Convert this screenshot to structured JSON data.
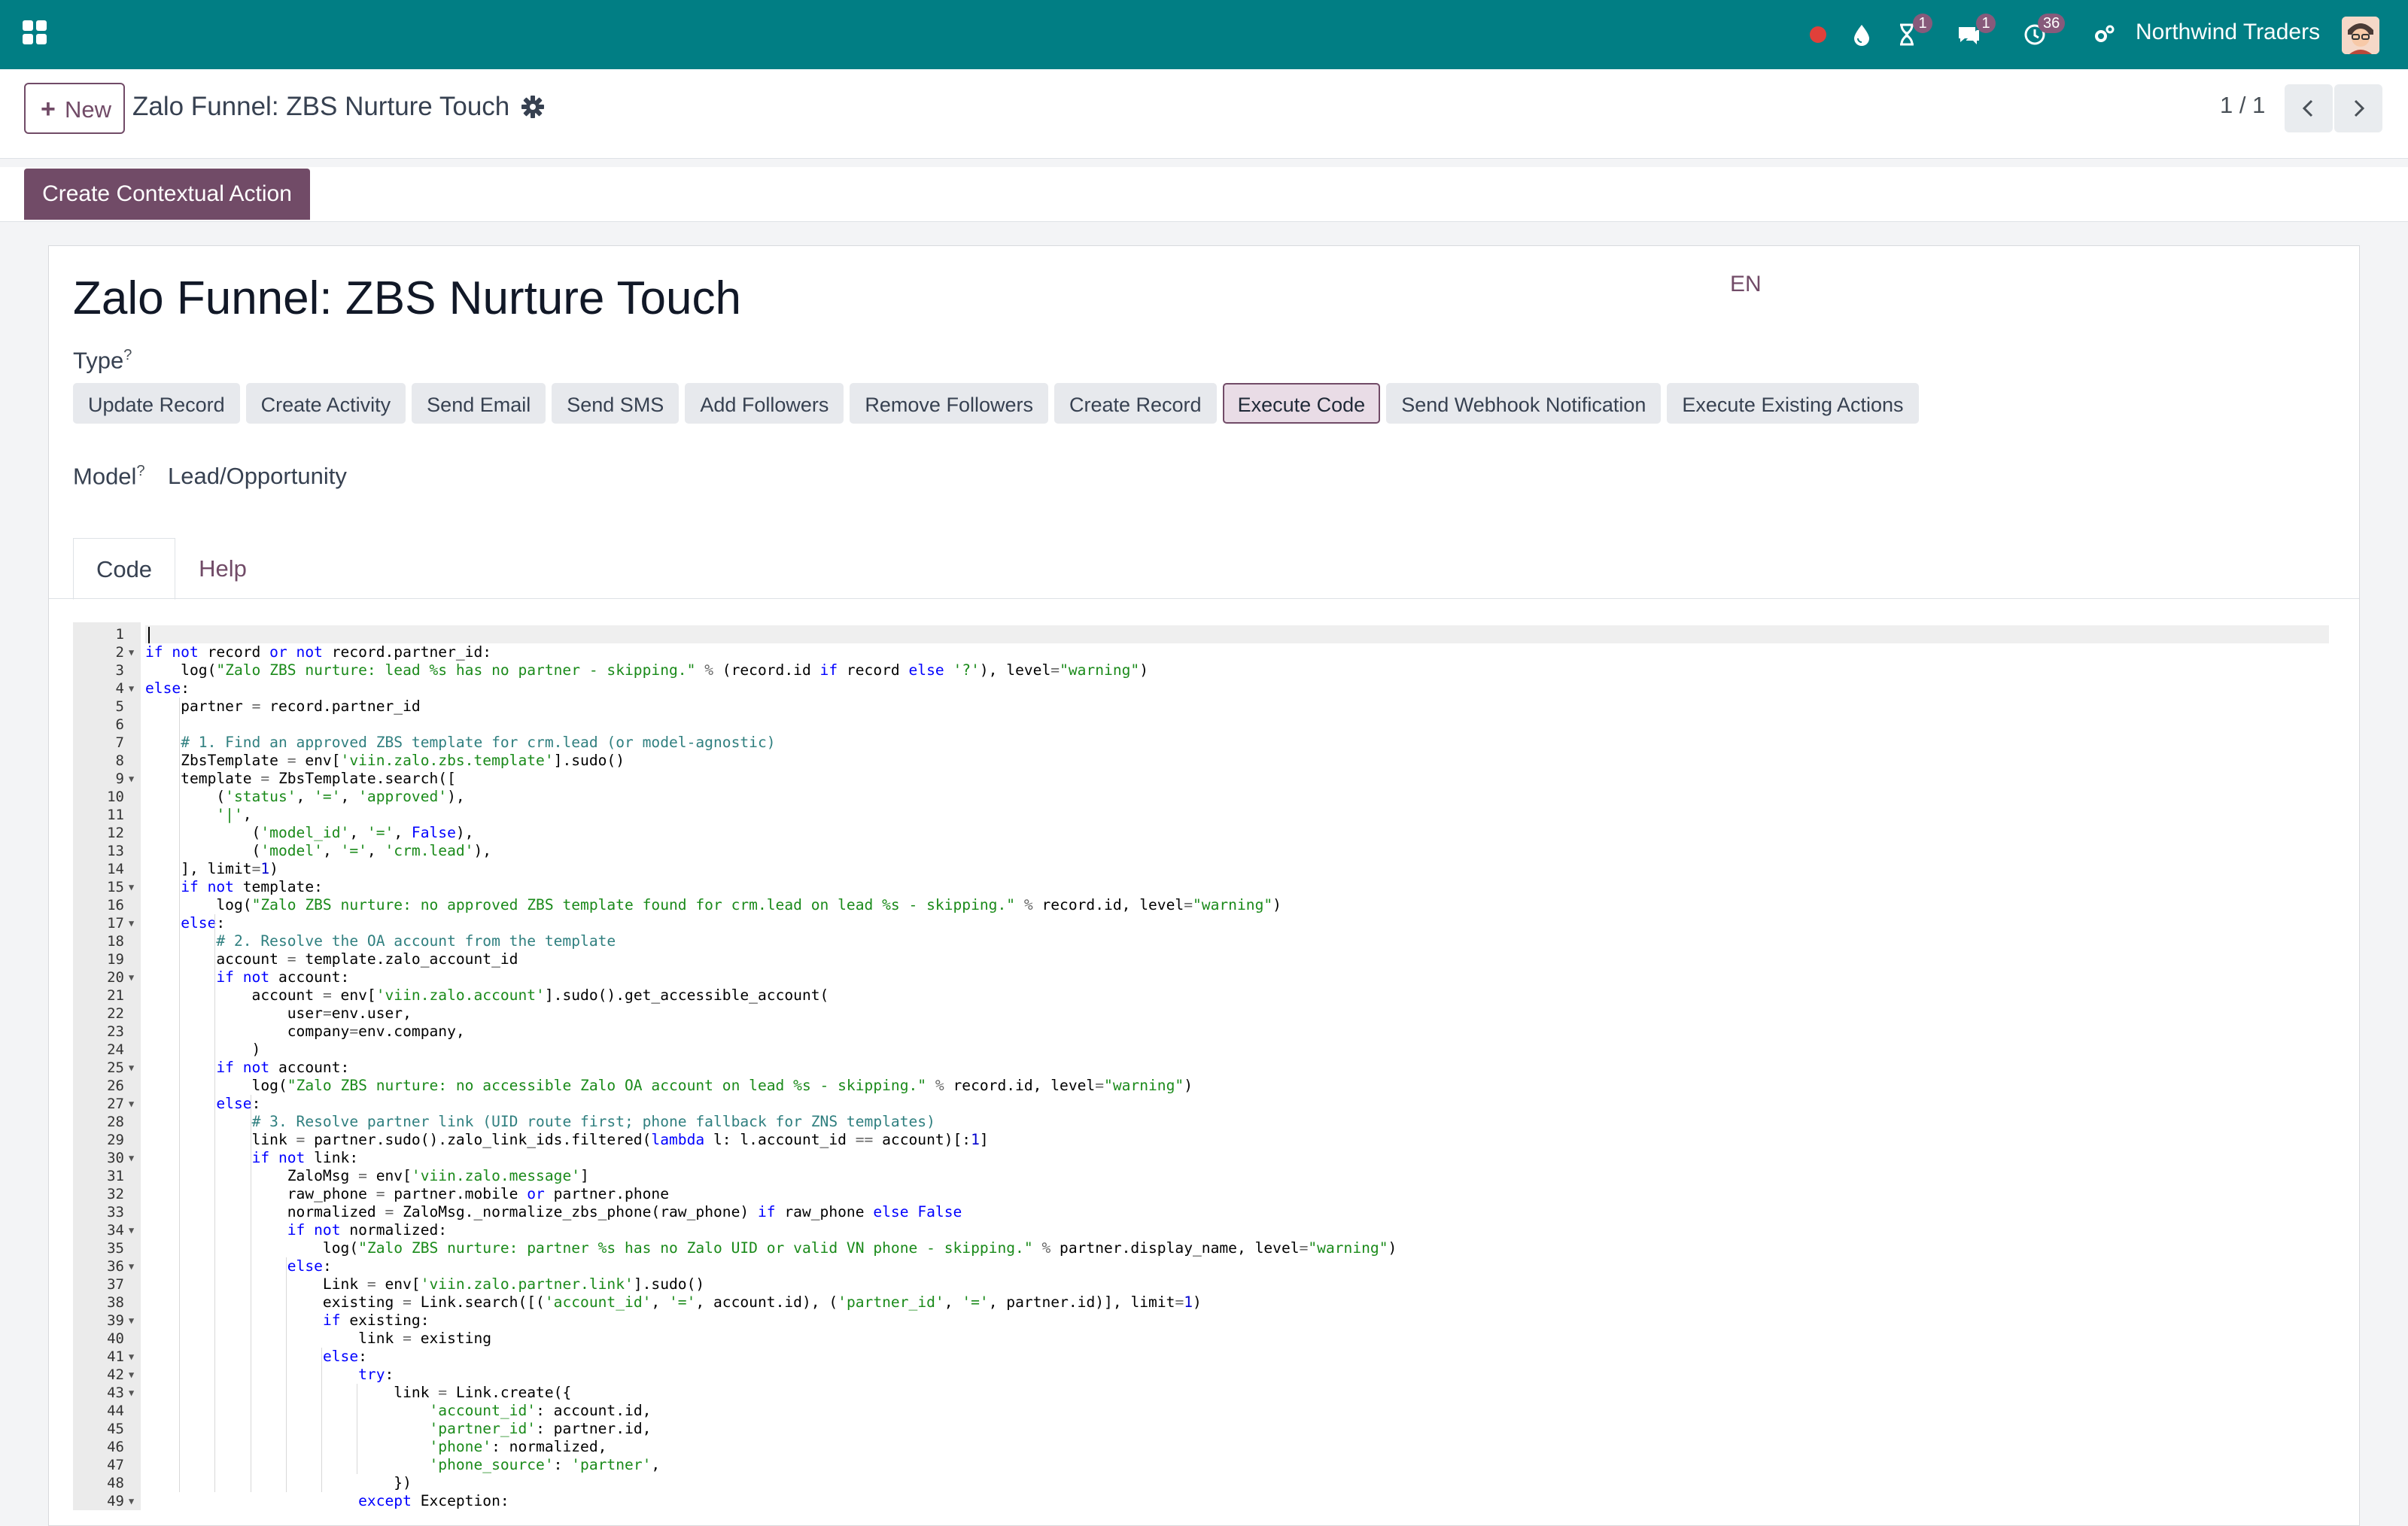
{
  "navbar": {
    "company": "Northwind Traders",
    "activity_badge": "1",
    "messages_badge": "1",
    "activities_badge": "36"
  },
  "control_panel": {
    "new_label": "New",
    "breadcrumb": "Zalo Funnel: ZBS Nurture Touch",
    "pager": "1 / 1"
  },
  "actions": {
    "create_contextual": "Create Contextual Action"
  },
  "form": {
    "name": "Zalo Funnel: ZBS Nurture Touch",
    "lang": "EN",
    "type_label": "Type",
    "type_help": "?",
    "types": [
      "Update Record",
      "Create Activity",
      "Send Email",
      "Send SMS",
      "Add Followers",
      "Remove Followers",
      "Create Record",
      "Execute Code",
      "Send Webhook Notification",
      "Execute Existing Actions"
    ],
    "active_type": "Execute Code",
    "model_label": "Model",
    "model_help": "?",
    "model_value": "Lead/Opportunity",
    "tabs": [
      "Code",
      "Help"
    ],
    "active_tab": "Code"
  },
  "code": [
    "",
    "if not record or not record.partner_id:",
    "    log(\"Zalo ZBS nurture: lead %s has no partner - skipping.\" % (record.id if record else '?'), level=\"warning\")",
    "else:",
    "    partner = record.partner_id",
    "",
    "    # 1. Find an approved ZBS template for crm.lead (or model-agnostic)",
    "    ZbsTemplate = env['viin.zalo.zbs.template'].sudo()",
    "    template = ZbsTemplate.search([",
    "        ('status', '=', 'approved'),",
    "        '|',",
    "            ('model_id', '=', False),",
    "            ('model', '=', 'crm.lead'),",
    "    ], limit=1)",
    "    if not template:",
    "        log(\"Zalo ZBS nurture: no approved ZBS template found for crm.lead on lead %s - skipping.\" % record.id, level=\"warning\")",
    "    else:",
    "        # 2. Resolve the OA account from the template",
    "        account = template.zalo_account_id",
    "        if not account:",
    "            account = env['viin.zalo.account'].sudo().get_accessible_account(",
    "                user=env.user,",
    "                company=env.company,",
    "            )",
    "        if not account:",
    "            log(\"Zalo ZBS nurture: no accessible Zalo OA account on lead %s - skipping.\" % record.id, level=\"warning\")",
    "        else:",
    "            # 3. Resolve partner link (UID route first; phone fallback for ZNS templates)",
    "            link = partner.sudo().zalo_link_ids.filtered(lambda l: l.account_id == account)[:1]",
    "            if not link:",
    "                ZaloMsg = env['viin.zalo.message']",
    "                raw_phone = partner.mobile or partner.phone",
    "                normalized = ZaloMsg._normalize_zbs_phone(raw_phone) if raw_phone else False",
    "                if not normalized:",
    "                    log(\"Zalo ZBS nurture: partner %s has no Zalo UID or valid VN phone - skipping.\" % partner.display_name, level=\"warning\")",
    "                else:",
    "                    Link = env['viin.zalo.partner.link'].sudo()",
    "                    existing = Link.search([('account_id', '=', account.id), ('partner_id', '=', partner.id)], limit=1)",
    "                    if existing:",
    "                        link = existing",
    "                    else:",
    "                        try:",
    "                            link = Link.create({",
    "                                'account_id': account.id,",
    "                                'partner_id': partner.id,",
    "                                'phone': normalized,",
    "                                'phone_source': 'partner',",
    "                            })",
    "                        except Exception:"
  ],
  "fold_lines": [
    2,
    4,
    9,
    15,
    17,
    20,
    25,
    27,
    30,
    34,
    36,
    39,
    41,
    42,
    43,
    49
  ],
  "colors": {
    "navbar": "#017e84",
    "primary": "#714b67",
    "record_indicator": "#e0403a"
  },
  "icons": [
    "apps-icon",
    "record-dot-icon",
    "water-drop-icon",
    "hourglass-icon",
    "chat-icon",
    "clock-icon",
    "settings-icon",
    "gear-icon",
    "chevron-left-icon",
    "chevron-right-icon"
  ]
}
